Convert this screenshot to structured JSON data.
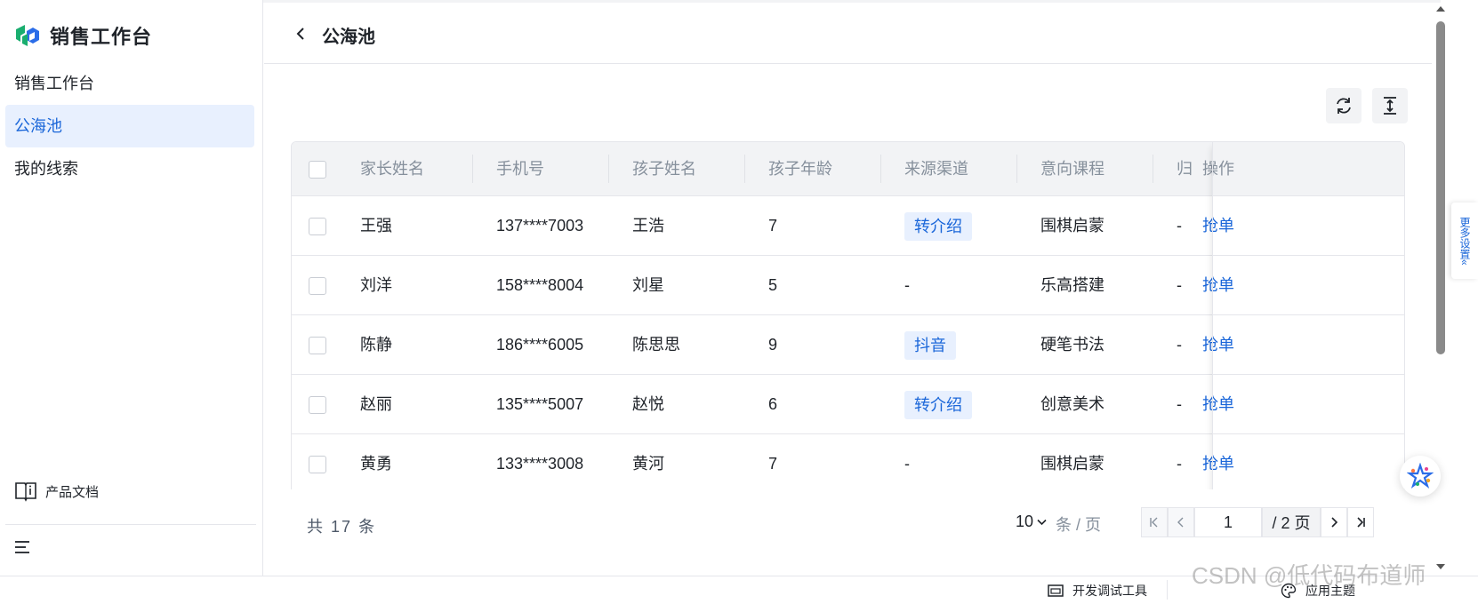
{
  "sidebar": {
    "brand": "销售工作台",
    "items": [
      {
        "label": "销售工作台"
      },
      {
        "label": "公海池"
      },
      {
        "label": "我的线索"
      }
    ],
    "docs_label": "产品文档"
  },
  "header": {
    "title": "公海池"
  },
  "table": {
    "columns": [
      "家长姓名",
      "手机号",
      "孩子姓名",
      "孩子年龄",
      "来源渠道",
      "意向课程",
      "归",
      "操作"
    ],
    "rows": [
      {
        "parent": "王强",
        "phone": "137****7003",
        "child": "王浩",
        "age": "7",
        "source": "转介绍",
        "course": "围棋启蒙",
        "extra": "-",
        "action": "抢单"
      },
      {
        "parent": "刘洋",
        "phone": "158****8004",
        "child": "刘星",
        "age": "5",
        "source": "-",
        "course": "乐高搭建",
        "extra": "-",
        "action": "抢单"
      },
      {
        "parent": "陈静",
        "phone": "186****6005",
        "child": "陈思思",
        "age": "9",
        "source": "抖音",
        "course": "硬笔书法",
        "extra": "-",
        "action": "抢单"
      },
      {
        "parent": "赵丽",
        "phone": "135****5007",
        "child": "赵悦",
        "age": "6",
        "source": "转介绍",
        "course": "创意美术",
        "extra": "-",
        "action": "抢单"
      },
      {
        "parent": "黄勇",
        "phone": "133****3008",
        "child": "黄河",
        "age": "7",
        "source": "-",
        "course": "围棋启蒙",
        "extra": "-",
        "action": "抢单"
      }
    ]
  },
  "pagination": {
    "total_prefix": "共",
    "total": "17",
    "total_suffix": "条",
    "page_size": "10",
    "per_page_label": "条 / 页",
    "current_page": "1",
    "total_pages": "/ 2 页"
  },
  "more_settings": "更多设置«",
  "bottom_bar": {
    "dev_tools": "开发调试工具",
    "theme": "应用主题"
  },
  "watermark": "CSDN @低代码布道师",
  "colors": {
    "accent": "#1a66d9",
    "accent_bg": "#e8f0fe",
    "header_bg": "#f2f3f5"
  }
}
